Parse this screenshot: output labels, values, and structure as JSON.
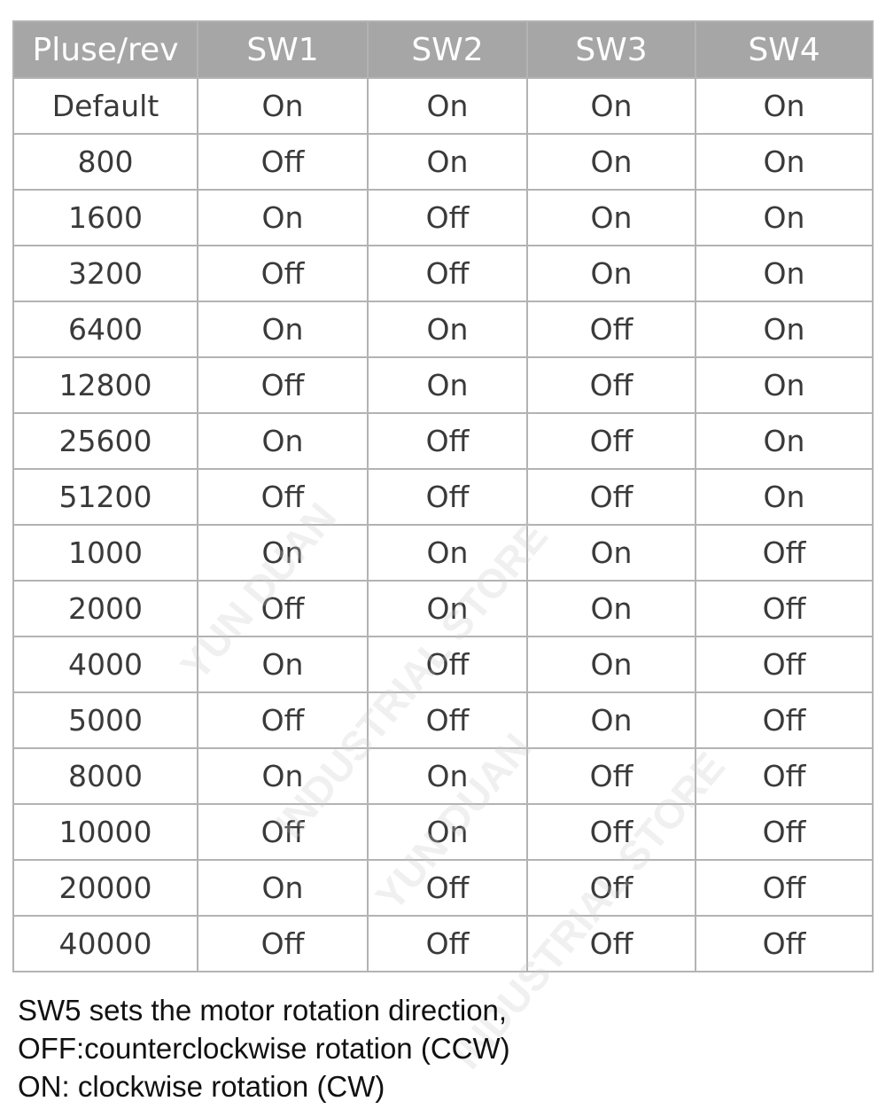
{
  "table": {
    "headers": [
      "Pluse/rev",
      "SW1",
      "SW2",
      "SW3",
      "SW4"
    ],
    "rows": [
      [
        "Default",
        "On",
        "On",
        "On",
        "On"
      ],
      [
        "800",
        "Off",
        "On",
        "On",
        "On"
      ],
      [
        "1600",
        "On",
        "Off",
        "On",
        "On"
      ],
      [
        "3200",
        "Off",
        "Off",
        "On",
        "On"
      ],
      [
        "6400",
        "On",
        "On",
        "Off",
        "On"
      ],
      [
        "12800",
        "Off",
        "On",
        "Off",
        "On"
      ],
      [
        "25600",
        "On",
        "Off",
        "Off",
        "On"
      ],
      [
        "51200",
        "Off",
        "Off",
        "Off",
        "On"
      ],
      [
        "1000",
        "On",
        "On",
        "On",
        "Off"
      ],
      [
        "2000",
        "Off",
        "On",
        "On",
        "Off"
      ],
      [
        "4000",
        "On",
        "Off",
        "On",
        "Off"
      ],
      [
        "5000",
        "Off",
        "Off",
        "On",
        "Off"
      ],
      [
        "8000",
        "On",
        "On",
        "Off",
        "Off"
      ],
      [
        "10000",
        "Off",
        "On",
        "Off",
        "Off"
      ],
      [
        "20000",
        "On",
        "Off",
        "Off",
        "Off"
      ],
      [
        "40000",
        "Off",
        "Off",
        "Off",
        "Off"
      ]
    ]
  },
  "notes": [
    "SW5 sets the motor rotation direction,",
    "OFF:counterclockwise rotation (CCW)",
    "ON: clockwise rotation (CW)"
  ],
  "watermark": [
    "YUN DUAN",
    "INDUSTRIAL STORE"
  ]
}
